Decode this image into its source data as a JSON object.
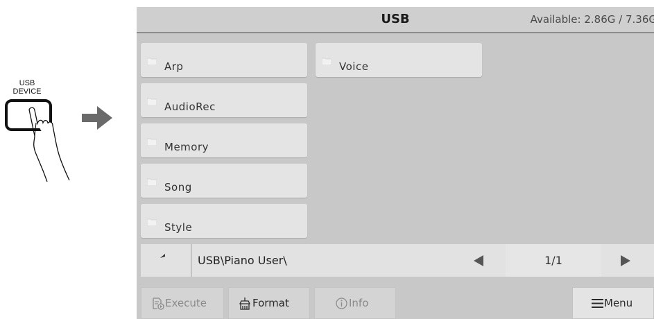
{
  "illustration": {
    "key_label_line1": "USB",
    "key_label_line2": "DEVICE"
  },
  "screen": {
    "title": "USB",
    "available": "Available: 2.86G / 7.36G",
    "folders": [
      {
        "name": "Arp"
      },
      {
        "name": "Voice"
      },
      {
        "name": "AudioRec"
      },
      {
        "name": "Memory"
      },
      {
        "name": "Song"
      },
      {
        "name": "Style"
      }
    ],
    "path": "USB\\Piano User\\",
    "page_indicator": "1/1",
    "buttons": {
      "execute": "Execute",
      "format": "Format",
      "info": "Info",
      "menu": "Menu"
    }
  },
  "colors": {
    "screen_bg": "#c8c8c8",
    "button_bg": "#e4e4e4",
    "disabled_text": "#8a8a8a"
  }
}
